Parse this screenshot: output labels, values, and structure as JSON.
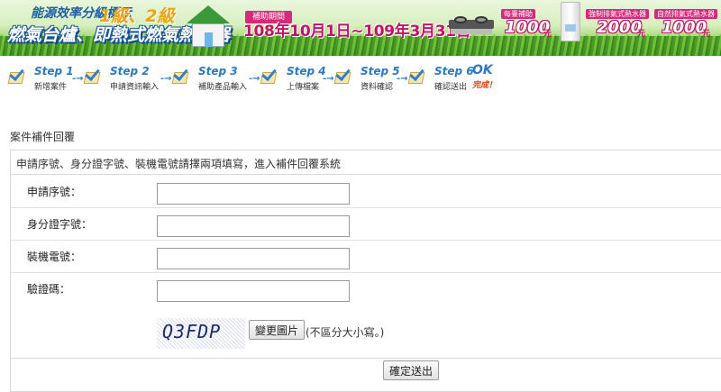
{
  "banner": {
    "title_line1": "能源效率分級標示",
    "levels": "1級、2級",
    "title_line2": "燃氣台爐、即熱式燃氣熱水器",
    "period_label": "補助期間",
    "period": "108年10月1日~109年3月31日",
    "subsidies": [
      {
        "label": "每臺補助",
        "amount": "1000",
        "unit": "元"
      },
      {
        "label": "強制排氣式熱水器",
        "amount": "2000",
        "unit": "元"
      },
      {
        "label": "自然排氣式熱水器",
        "amount": "1000",
        "unit": "元"
      }
    ]
  },
  "steps": [
    {
      "name": "Step 1",
      "desc": "新增案件"
    },
    {
      "name": "Step 2",
      "desc": "申請資訊輸入"
    },
    {
      "name": "Step 3",
      "desc": "補助產品輸入"
    },
    {
      "name": "Step 4",
      "desc": "上傳檔案"
    },
    {
      "name": "Step 5",
      "desc": "資料確認"
    },
    {
      "name": "Step 6",
      "desc": "確認送出"
    }
  ],
  "ok": {
    "label": "OK",
    "sub": "完成！"
  },
  "form": {
    "section_title": "案件補件回覆",
    "notice": "申請序號、身分證字號、裝機電號請擇兩項填寫，進入補件回覆系統",
    "fields": [
      {
        "label": "申請序號：",
        "value": ""
      },
      {
        "label": "身分證字號：",
        "value": ""
      },
      {
        "label": "裝機電號：",
        "value": ""
      },
      {
        "label": "驗證碼：",
        "value": ""
      }
    ],
    "captcha_code": "Q3FDP",
    "change_image_label": "變更圖片",
    "case_note": "(不區分大小寫。)",
    "submit_label": "確定送出"
  }
}
